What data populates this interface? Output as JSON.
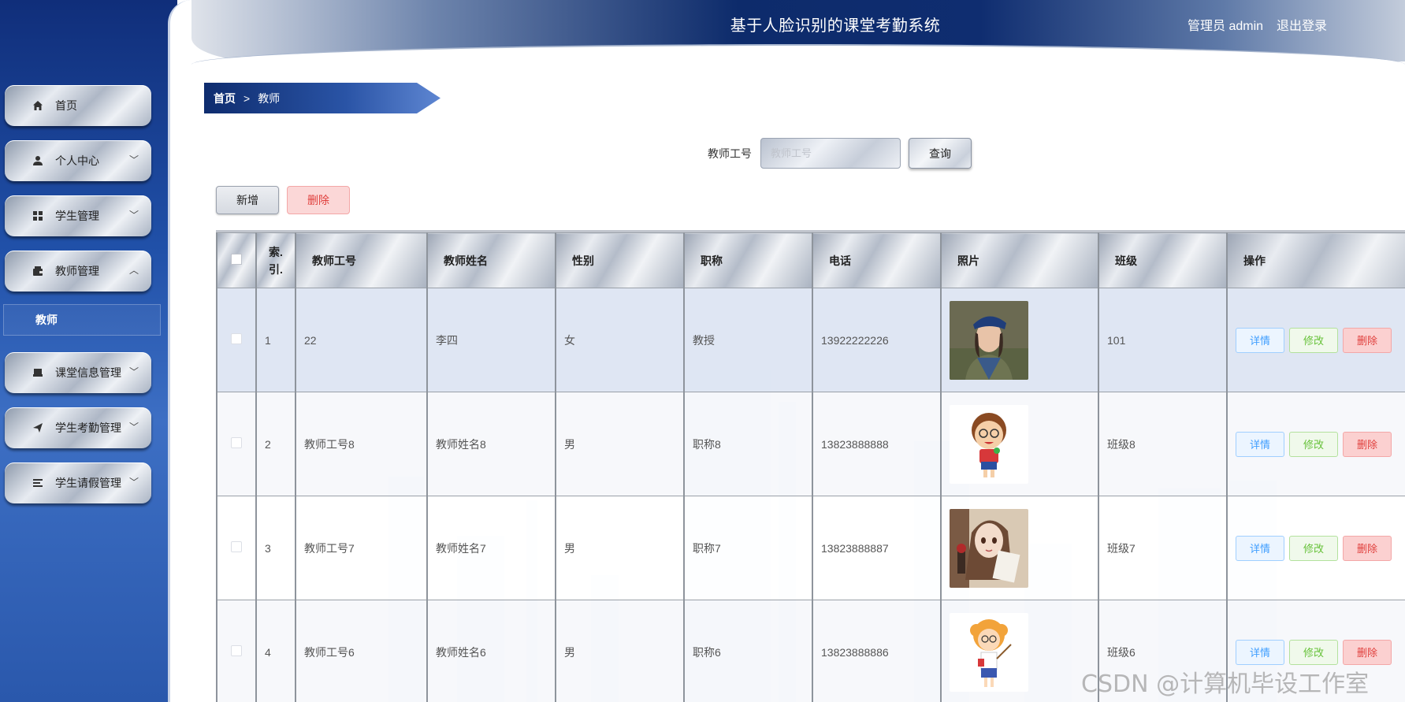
{
  "header": {
    "title": "基于人脸识别的课堂考勤系统",
    "user": "管理员 admin",
    "logout": "退出登录"
  },
  "sidebar": {
    "items": [
      {
        "label": "首页",
        "icon": "home-icon",
        "expandable": false
      },
      {
        "label": "个人中心",
        "icon": "user-icon",
        "expandable": true
      },
      {
        "label": "学生管理",
        "icon": "grid-icon",
        "expandable": true
      },
      {
        "label": "教师管理",
        "icon": "wallet-icon",
        "expandable": true,
        "expanded": true
      },
      {
        "label": "课堂信息管理",
        "icon": "printer-icon",
        "expandable": true
      },
      {
        "label": "学生考勤管理",
        "icon": "send-icon",
        "expandable": true
      },
      {
        "label": "学生请假管理",
        "icon": "list-icon",
        "expandable": true
      }
    ],
    "sub_item": "教师"
  },
  "breadcrumb": {
    "home": "首页",
    "separator": ">",
    "current": "教师"
  },
  "search": {
    "label": "教师工号",
    "placeholder": "教师工号",
    "button": "查询"
  },
  "actions": {
    "add": "新增",
    "delete": "删除"
  },
  "table": {
    "headers": [
      "",
      "索引",
      "教师工号",
      "教师姓名",
      "性别",
      "职称",
      "电话",
      "照片",
      "班级",
      "操作"
    ],
    "index_header_lines": [
      "索.",
      "引."
    ],
    "rows": [
      {
        "index": "1",
        "id": "22",
        "name": "李四",
        "gender": "女",
        "title": "教授",
        "phone": "13922222226",
        "photo": "soldier-woman-photo",
        "class": "101"
      },
      {
        "index": "2",
        "id": "教师工号8",
        "name": "教师姓名8",
        "gender": "男",
        "title": "职称8",
        "phone": "13823888888",
        "photo": "cartoon-teacher-boy",
        "class": "班级8"
      },
      {
        "index": "3",
        "id": "教师工号7",
        "name": "教师姓名7",
        "gender": "男",
        "title": "职称7",
        "phone": "13823888887",
        "photo": "anime-girl",
        "class": "班级7"
      },
      {
        "index": "4",
        "id": "教师工号6",
        "name": "教师姓名6",
        "gender": "男",
        "title": "职称6",
        "phone": "13823888886",
        "photo": "cartoon-teacher-girl",
        "class": "班级6"
      }
    ],
    "row_ops": {
      "detail": "详情",
      "edit": "修改",
      "delete": "删除"
    }
  },
  "watermark": "CSDN @计算机毕设工作室",
  "colors": {
    "primary": "#1a3a84",
    "danger": "#e0403d",
    "info": "#409eff",
    "success": "#67c23a"
  }
}
